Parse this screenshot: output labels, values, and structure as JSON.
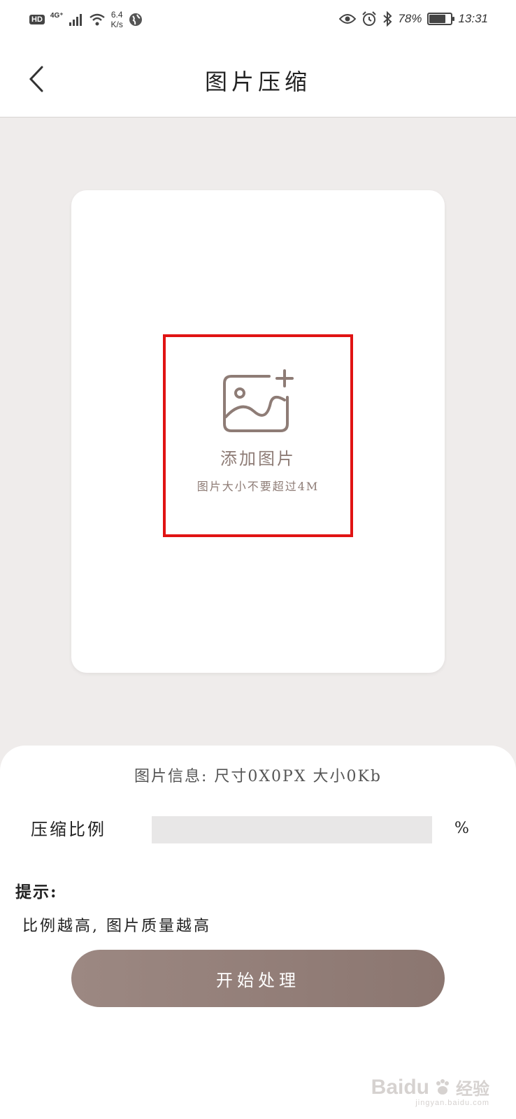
{
  "status_bar": {
    "hd": "HD",
    "network": "4G⁺",
    "speed_value": "6.4",
    "speed_unit": "K/s",
    "battery_percent": "78%",
    "battery_level": 0.78,
    "time": "13:31"
  },
  "header": {
    "title": "图片压缩"
  },
  "upload": {
    "label": "添加图片",
    "hint": "图片大小不要超过4M"
  },
  "panel": {
    "info": "图片信息: 尺寸0X0PX  大小0Kb",
    "ratio_label": "压缩比例",
    "ratio_value": "",
    "percent": "%",
    "tips_title": "提示:",
    "tips_text": "比例越高, 图片质量越高",
    "start_button": "开始处理"
  },
  "watermark": {
    "brand": "Bai",
    "brand_suffix": "du",
    "cn": "经验",
    "url": "jingyan.baidu.com"
  },
  "colors": {
    "accent": "#8e7c76",
    "highlight_border": "#e01313",
    "page_bg": "#efeceb"
  }
}
